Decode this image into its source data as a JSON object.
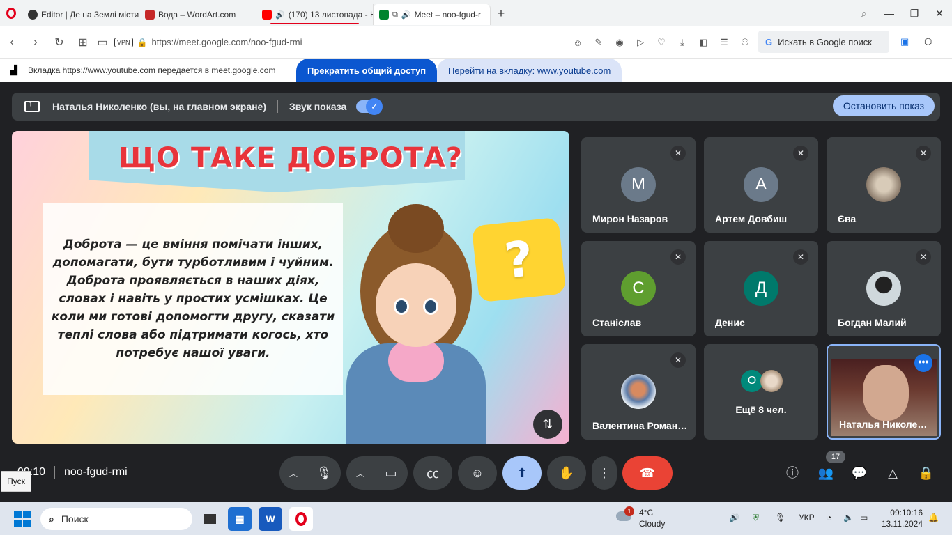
{
  "browser": {
    "tabs": [
      {
        "title": "Editor | Де на Землі містить",
        "icon": "editor-favicon",
        "color": "#333"
      },
      {
        "title": "Вода – WordArt.com",
        "icon": "wordart-favicon",
        "color": "#c62828"
      },
      {
        "title": "(170) 13 листопада - Ю",
        "icon": "youtube-favicon",
        "color": "#ff0000"
      },
      {
        "title": "Meet – noo-fgud-r",
        "icon": "meet-favicon",
        "color": "#00832d"
      }
    ],
    "url": "https://meet.google.com/noo-fgud-rmi",
    "vpn_label": "VPN",
    "search_placeholder": "Искать в Google поиск"
  },
  "share_bar": {
    "message": "Вкладка https://www.youtube.com передается в meet.google.com",
    "stop_label": "Прекратить общий доступ",
    "goto_label": "Перейти на вкладку: www.youtube.com"
  },
  "meet": {
    "presenter_text": "Наталья Николенко (вы, на главном экране)",
    "sound_label": "Звук показа",
    "stop_show_label": "Остановить показ",
    "slide": {
      "title": "ЩО ТАКЕ ДОБРОТА?",
      "body": "Доброта — це вміння помічати інших, допомагати, бути турботливим і чуйним. Доброта проявляється в наших діях, словах і навіть у простих усмішках. Це коли ми готові допомогти другу, сказати теплі слова або підтримати когось, хто потребує нашої уваги.",
      "bubble": "?"
    },
    "participants": [
      {
        "name": "Мирон Назаров",
        "initial": "М",
        "color": "#6b7a8a"
      },
      {
        "name": "Артем Довбиш",
        "initial": "А",
        "color": "#6b7a8a"
      },
      {
        "name": "Єва",
        "initial": "",
        "color": "#8a7a6a"
      },
      {
        "name": "Станіслав",
        "initial": "С",
        "color": "#5f9e2f"
      },
      {
        "name": "Денис",
        "initial": "Д",
        "color": "#00796b"
      },
      {
        "name": "Богдан Малий",
        "initial": "",
        "color": "#cfd8dc"
      },
      {
        "name": "Валентина Роман…",
        "initial": "",
        "color": "#5b7ba8"
      }
    ],
    "more_tile": {
      "label": "Ещё 8 чел.",
      "initial": "О",
      "color": "#00897b"
    },
    "self_tile": {
      "name": "Наталья Николен…"
    },
    "time": "09:10",
    "meeting_code": "noo-fgud-rmi",
    "people_count": "17"
  },
  "tooltip": "Пуск",
  "taskbar": {
    "search_placeholder": "Поиск",
    "weather_temp": "4°C",
    "weather_desc": "Cloudy",
    "weather_badge": "1",
    "lang": "УКР",
    "time": "09:10:16",
    "date": "13.11.2024"
  }
}
